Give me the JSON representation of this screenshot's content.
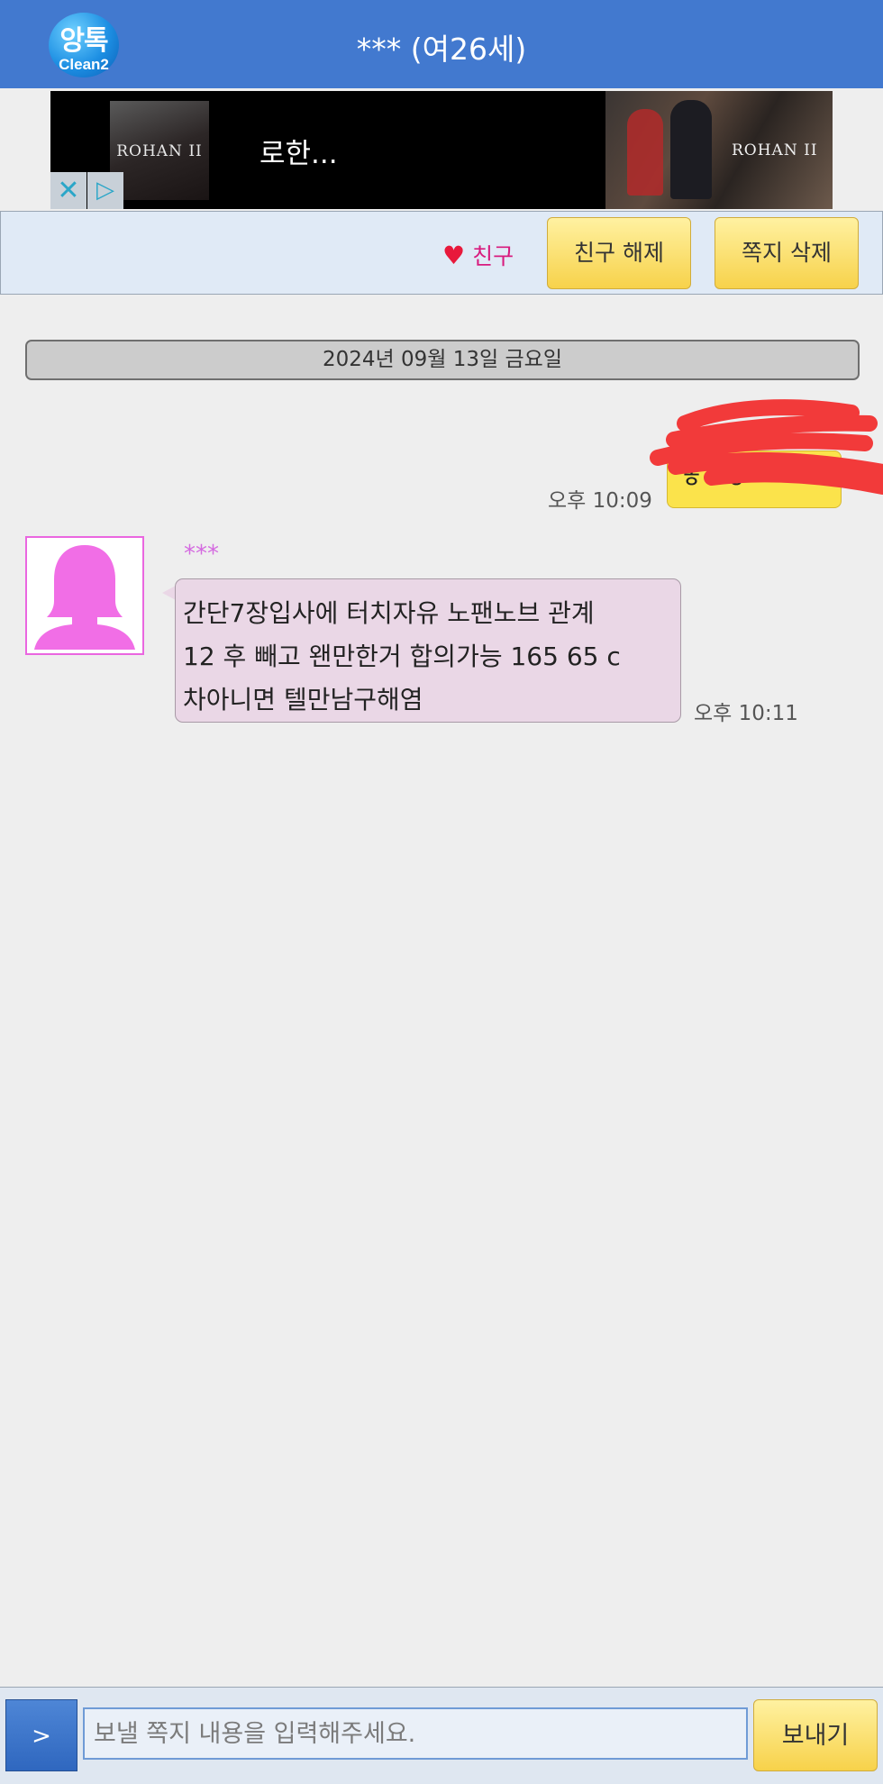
{
  "header": {
    "logo_text": "앙톡",
    "logo_sub": "Clean2",
    "title": "*** (여26세)"
  },
  "ad": {
    "thumb_logo": "ROHAN II",
    "text": "로한...",
    "banner_logo": "ROHAN II",
    "close_icon": "✕",
    "info_icon": "▷"
  },
  "actions": {
    "friend_label": "친구",
    "unfriend_label": "친구 해제",
    "delete_label": "쪽지 삭제"
  },
  "chat": {
    "date": "2024년 09월 13일 금요일",
    "outgoing": {
      "time": "오후 10:09",
      "text": "ㅎㅇㅎ"
    },
    "incoming": {
      "sender": "***",
      "lines": [
        "간단7장입사에 터치자유 노팬노브 관계",
        "12 후 빼고 왠만한거 합의가능 165 65 c",
        "차아니면 텔만남구해염"
      ],
      "time": "오후 10:11"
    }
  },
  "composer": {
    "expand_label": ">",
    "placeholder": "보낼 쪽지 내용을 입력해주세요.",
    "send_label": "보내기"
  },
  "colors": {
    "header_bg": "#4279cf",
    "outgoing_bubble": "#fbe34b",
    "incoming_bubble": "#ead7e6",
    "avatar_pink": "#f16ee6",
    "friend_pink": "#d81b7e",
    "scribble_red": "#f23a3a"
  }
}
